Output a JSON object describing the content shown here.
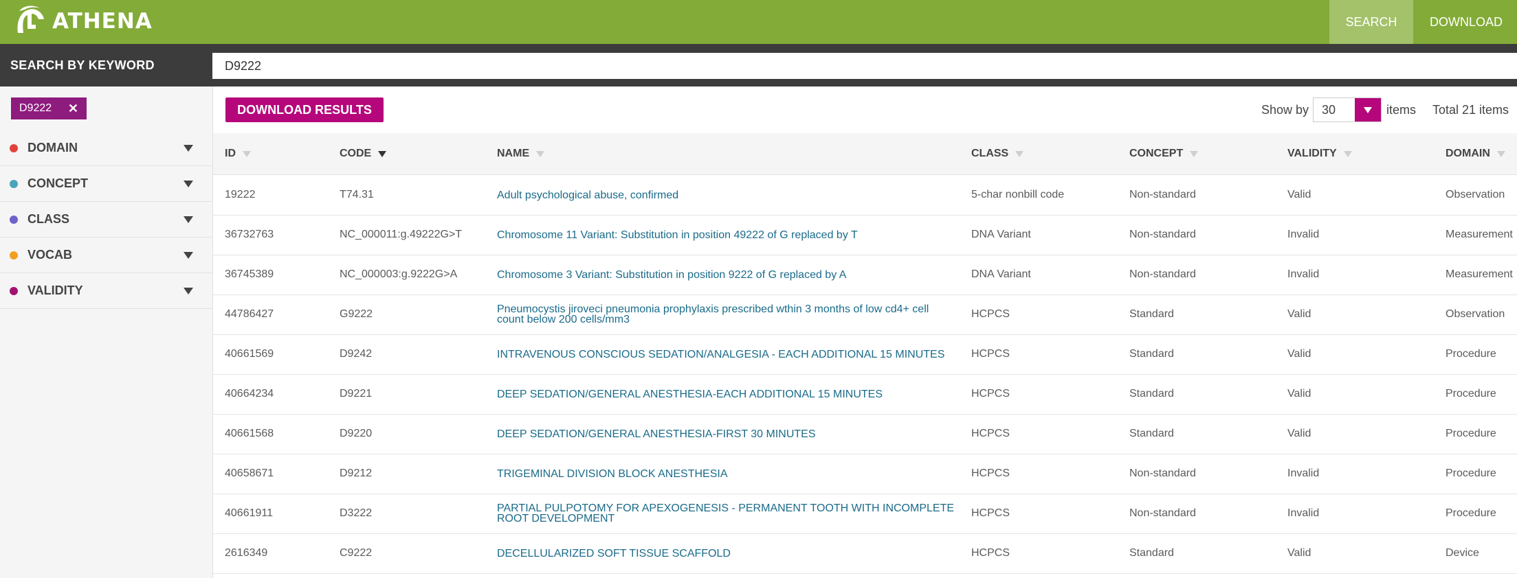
{
  "app": {
    "logo_text": "ATHENA"
  },
  "nav": {
    "search": "SEARCH",
    "download": "DOWNLOAD"
  },
  "search": {
    "label": "SEARCH BY KEYWORD",
    "value": "D9222"
  },
  "filters": {
    "active_chip": "D9222",
    "facets": [
      {
        "label": "DOMAIN",
        "color": "#e2413b"
      },
      {
        "label": "CONCEPT",
        "color": "#4ba4bd"
      },
      {
        "label": "CLASS",
        "color": "#6c63c9"
      },
      {
        "label": "VOCAB",
        "color": "#f2a01f"
      },
      {
        "label": "VALIDITY",
        "color": "#a0136f"
      }
    ]
  },
  "toolbar": {
    "download_results": "DOWNLOAD RESULTS",
    "show_by": "Show by",
    "page_size": "30",
    "items": "items",
    "total": "Total 21 items"
  },
  "table": {
    "columns": [
      "ID",
      "CODE",
      "NAME",
      "CLASS",
      "CONCEPT",
      "VALIDITY",
      "DOMAIN"
    ],
    "sorted_column": "CODE",
    "rows": [
      {
        "id": "19222",
        "code": "T74.31",
        "name": "Adult psychological abuse, confirmed",
        "class": "5-char nonbill code",
        "concept": "Non-standard",
        "validity": "Valid",
        "domain": "Observation"
      },
      {
        "id": "36732763",
        "code": "NC_000011:g.49222G>T",
        "name": "Chromosome 11 Variant: Substitution in position 49222 of G replaced by T",
        "class": "DNA Variant",
        "concept": "Non-standard",
        "validity": "Invalid",
        "domain": "Measurement"
      },
      {
        "id": "36745389",
        "code": "NC_000003:g.9222G>A",
        "name": "Chromosome 3 Variant: Substitution in position 9222 of G replaced by A",
        "class": "DNA Variant",
        "concept": "Non-standard",
        "validity": "Invalid",
        "domain": "Measurement"
      },
      {
        "id": "44786427",
        "code": "G9222",
        "name": "Pneumocystis jiroveci pneumonia prophylaxis prescribed wthin 3 months of low cd4+ cell count below 200 cells/mm3",
        "class": "HCPCS",
        "concept": "Standard",
        "validity": "Valid",
        "domain": "Observation"
      },
      {
        "id": "40661569",
        "code": "D9242",
        "name": "INTRAVENOUS CONSCIOUS SEDATION/ANALGESIA - EACH ADDITIONAL 15 MINUTES",
        "class": "HCPCS",
        "concept": "Standard",
        "validity": "Valid",
        "domain": "Procedure"
      },
      {
        "id": "40664234",
        "code": "D9221",
        "name": "DEEP SEDATION/GENERAL ANESTHESIA-EACH ADDITIONAL 15 MINUTES",
        "class": "HCPCS",
        "concept": "Standard",
        "validity": "Valid",
        "domain": "Procedure"
      },
      {
        "id": "40661568",
        "code": "D9220",
        "name": "DEEP SEDATION/GENERAL ANESTHESIA-FIRST 30 MINUTES",
        "class": "HCPCS",
        "concept": "Standard",
        "validity": "Valid",
        "domain": "Procedure"
      },
      {
        "id": "40658671",
        "code": "D9212",
        "name": "TRIGEMINAL DIVISION BLOCK ANESTHESIA",
        "class": "HCPCS",
        "concept": "Non-standard",
        "validity": "Invalid",
        "domain": "Procedure"
      },
      {
        "id": "40661911",
        "code": "D3222",
        "name": "PARTIAL PULPOTOMY FOR APEXOGENESIS - PERMANENT TOOTH WITH INCOMPLETE ROOT DEVELOPMENT",
        "class": "HCPCS",
        "concept": "Non-standard",
        "validity": "Invalid",
        "domain": "Procedure"
      },
      {
        "id": "2616349",
        "code": "C9222",
        "name": "DECELLULARIZED SOFT TISSUE SCAFFOLD",
        "class": "HCPCS",
        "concept": "Standard",
        "validity": "Valid",
        "domain": "Device"
      }
    ]
  }
}
